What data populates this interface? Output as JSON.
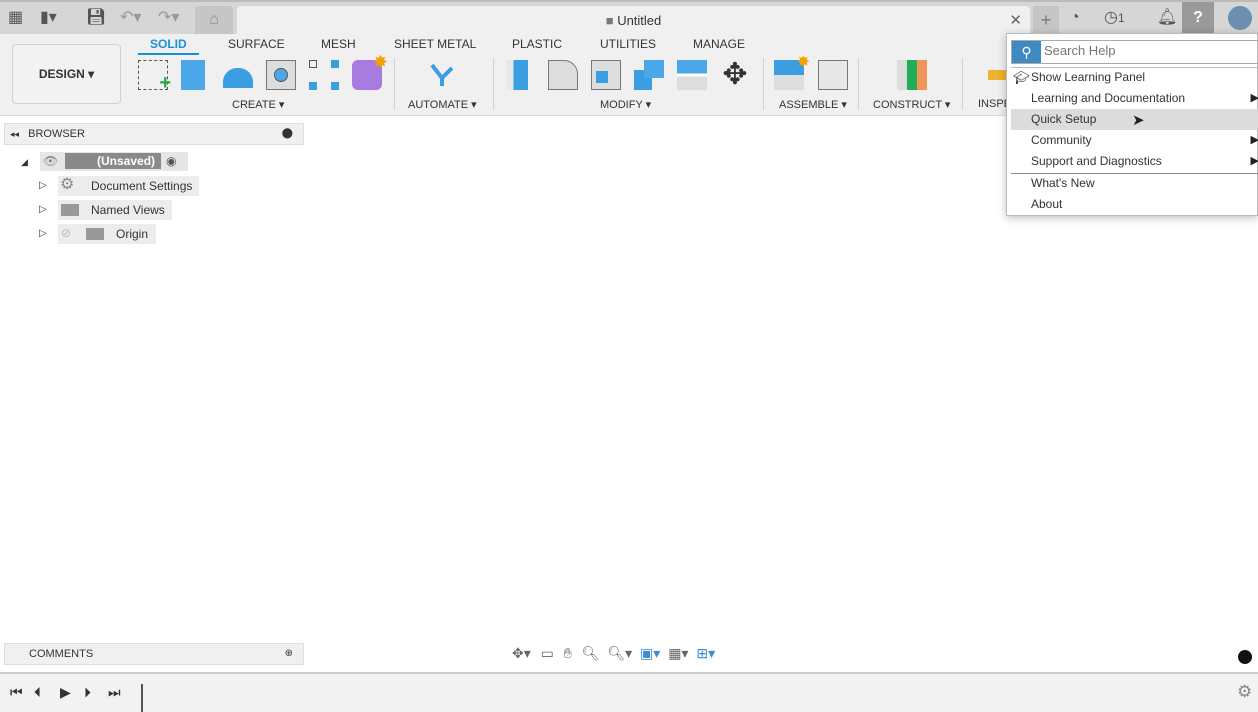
{
  "topbar": {
    "title": "Untitled",
    "notification_count": "1"
  },
  "toolbar": {
    "workspace": "DESIGN",
    "tabs": [
      "SOLID",
      "SURFACE",
      "MESH",
      "SHEET METAL",
      "PLASTIC",
      "UTILITIES",
      "MANAGE"
    ],
    "active_tab": "SOLID",
    "groups": [
      "CREATE",
      "AUTOMATE",
      "MODIFY",
      "ASSEMBLE",
      "CONSTRUCT",
      "INSPE"
    ]
  },
  "browser": {
    "title": "BROWSER",
    "root": "(Unsaved)",
    "items": [
      "Document Settings",
      "Named Views",
      "Origin"
    ]
  },
  "comments": {
    "title": "COMMENTS"
  },
  "help_menu": {
    "search_placeholder": "Search Help",
    "items": [
      {
        "label": "Show Learning Panel"
      },
      {
        "label": "Learning and Documentation",
        "submenu": true
      },
      {
        "label": "Quick Setup",
        "highlighted": true
      },
      {
        "label": "Community",
        "submenu": true
      },
      {
        "label": "Support and Diagnostics",
        "submenu": true
      },
      {
        "label": "What's New"
      },
      {
        "label": "About"
      }
    ]
  },
  "colors": {
    "accent": "#1a8fd6",
    "search_icon_bg": "#3f8ac0"
  }
}
